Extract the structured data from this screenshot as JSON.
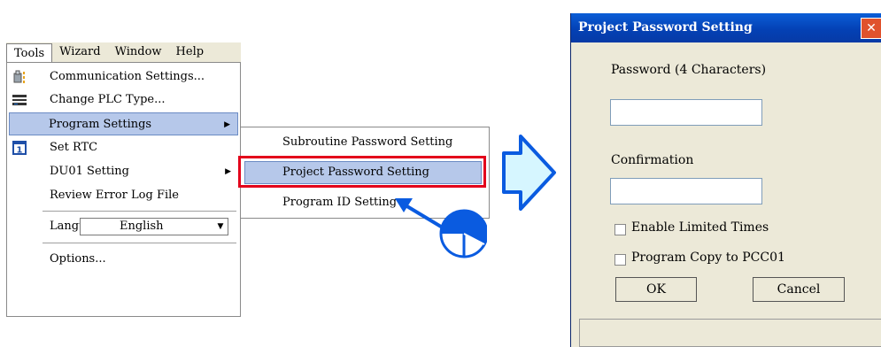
{
  "menubar": {
    "items": [
      "Tools",
      "Wizard",
      "Window",
      "Help"
    ]
  },
  "tools_menu": {
    "items": [
      {
        "label": "Communication Settings...",
        "icon": "communication-icon"
      },
      {
        "label": "Change PLC Type...",
        "icon": "plc-type-icon"
      },
      {
        "label": "Program Settings",
        "submenu": true
      },
      {
        "label": "Set RTC",
        "icon": "calendar-icon"
      },
      {
        "label": "DU01 Setting",
        "submenu": true
      },
      {
        "label": "Review Error Log File"
      },
      {
        "label": "Language"
      },
      {
        "label": "Options..."
      }
    ],
    "language_value": "English"
  },
  "submenu": {
    "items": [
      "Subroutine Password Setting",
      "Project Password Setting",
      "Program ID Setting"
    ],
    "highlighted": "Project Password Setting"
  },
  "dialog": {
    "title": "Project Password Setting",
    "password_label": "Password (4 Characters)",
    "password_value": "",
    "confirmation_label": "Confirmation",
    "confirmation_value": "",
    "enable_limited_times_label": "Enable Limited Times",
    "program_copy_label": "Program Copy to PCC01",
    "ok_label": "OK",
    "cancel_label": "Cancel"
  },
  "colors": {
    "highlight": "#b6c8ea",
    "annotation_blue": "#0a5be0",
    "arrow_fill": "#d6f6ff",
    "red_frame": "#e3001b"
  }
}
